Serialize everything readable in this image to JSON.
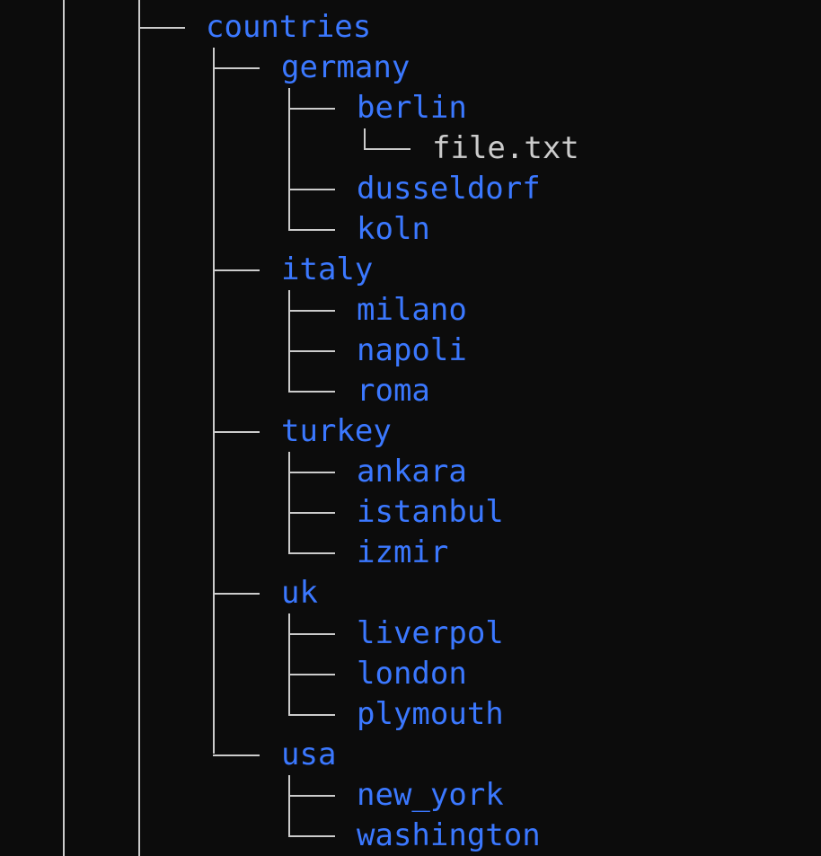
{
  "colors": {
    "background": "#0c0c0c",
    "directory": "#3b78ff",
    "file": "#cccccc",
    "tree_lines": "#cccccc"
  },
  "tree": {
    "root": "countries",
    "countries": [
      {
        "name": "germany",
        "children": [
          {
            "name": "berlin",
            "children": [
              {
                "name": "file.txt",
                "type": "file"
              }
            ]
          },
          {
            "name": "dusseldorf"
          },
          {
            "name": "koln"
          }
        ]
      },
      {
        "name": "italy",
        "children": [
          {
            "name": "milano"
          },
          {
            "name": "napoli"
          },
          {
            "name": "roma"
          }
        ]
      },
      {
        "name": "turkey",
        "children": [
          {
            "name": "ankara"
          },
          {
            "name": "istanbul"
          },
          {
            "name": "izmir"
          }
        ]
      },
      {
        "name": "uk",
        "children": [
          {
            "name": "liverpol"
          },
          {
            "name": "london"
          },
          {
            "name": "plymouth"
          }
        ]
      },
      {
        "name": "usa",
        "children": [
          {
            "name": "new_york"
          },
          {
            "name": "washington"
          }
        ]
      }
    ]
  }
}
